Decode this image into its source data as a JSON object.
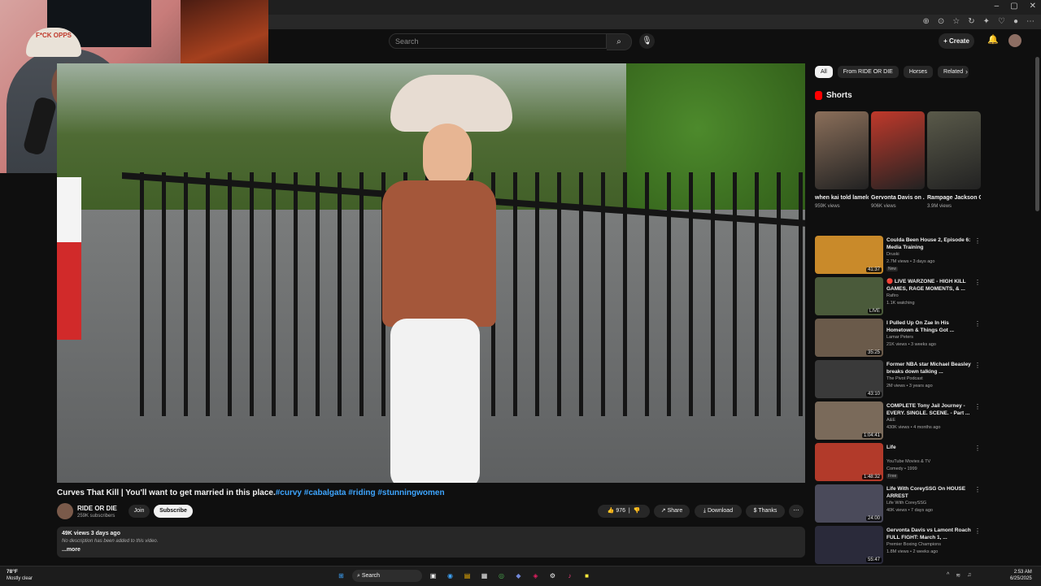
{
  "window": {
    "minimize": "–",
    "maximize": "▢",
    "close": "✕"
  },
  "header": {
    "search_placeholder": "Search",
    "create_label": "Create"
  },
  "webcam": {
    "hat_text": "F*CK OPPS"
  },
  "video": {
    "title": "Curves That Kill | You'll want to get married in this place.",
    "hashtags": "#curvy #cabalgata #riding #stunningwomen",
    "channel": "RIDE OR DIE",
    "subscribers": "259K subscribers",
    "join_label": "Join",
    "subscribe_label": "Subscribe",
    "likes": "976",
    "share_label": "Share",
    "download_label": "Download",
    "thanks_label": "Thanks",
    "meta": "49K views  3 days ago",
    "description": "No description has been added to this video.",
    "more_label": "...more"
  },
  "chips": [
    "All",
    "From RIDE OR DIE",
    "Horses",
    "Related"
  ],
  "shorts": {
    "heading": "Shorts",
    "items": [
      {
        "title": "when kai told lameloball t...",
        "views": "959K views",
        "color": "#8b6f5a"
      },
      {
        "title": "Gervonta Davis on ...",
        "views": "906K views",
        "color": "#c0392b"
      },
      {
        "title": "Rampage Jackson G...",
        "views": "3.9M views",
        "color": "#5a5a4a"
      }
    ]
  },
  "recs": [
    {
      "title": "Coulda Been House 2, Episode 6: Media Training",
      "channel": "Druski",
      "meta": "2.7M views • 3 days ago",
      "duration": "41:37",
      "badge": "New",
      "color": "#c98a2a"
    },
    {
      "title": "🔴 LIVE WARZONE - HIGH KILL GAMES, RAGE MOMENTS, & ...",
      "channel": "Rafiro",
      "meta": "1.1K watching",
      "duration": "LIVE",
      "badge": "",
      "color": "#4a5a3a"
    },
    {
      "title": "I Pulled Up On Zae In His Hometown & Things Got ...",
      "channel": "Lamar Peters",
      "meta": "21K views • 3 weeks ago",
      "duration": "35:25",
      "badge": "",
      "color": "#6a5a4a"
    },
    {
      "title": "Former NBA star Michael Beasley breaks down talking ...",
      "channel": "The Pivot Podcast",
      "meta": "2M views • 3 years ago",
      "duration": "43:10",
      "badge": "",
      "color": "#3a3a3a"
    },
    {
      "title": "COMPLETE Tony Jail Journey - EVERY. SINGLE. SCENE. - Part ...",
      "channel": "A&E",
      "meta": "430K views • 4 months ago",
      "duration": "1:04:41",
      "badge": "",
      "color": "#7a6a5a"
    },
    {
      "title": "Life",
      "channel": "YouTube Movies & TV",
      "meta": "Comedy • 1999",
      "duration": "1:48:32",
      "badge": "Free",
      "color": "#b23a2a"
    },
    {
      "title": "Life With CoreySSG On HOUSE ARREST",
      "channel": "Life With CoreySSG",
      "meta": "40K views • 7 days ago",
      "duration": "24:00",
      "badge": "",
      "color": "#4a4a5a"
    },
    {
      "title": "Gervonta Davis vs Lamont Roach FULL FIGHT: March 1, ...",
      "channel": "Premier Boxing Champions",
      "meta": "1.8M views • 2 weeks ago",
      "duration": "55:47",
      "badge": "",
      "color": "#2a2a3a"
    }
  ],
  "taskbar": {
    "temp": "78°F",
    "weather": "Mostly clear",
    "search": "Search",
    "time": "2:53 AM",
    "date": "6/25/2025"
  }
}
